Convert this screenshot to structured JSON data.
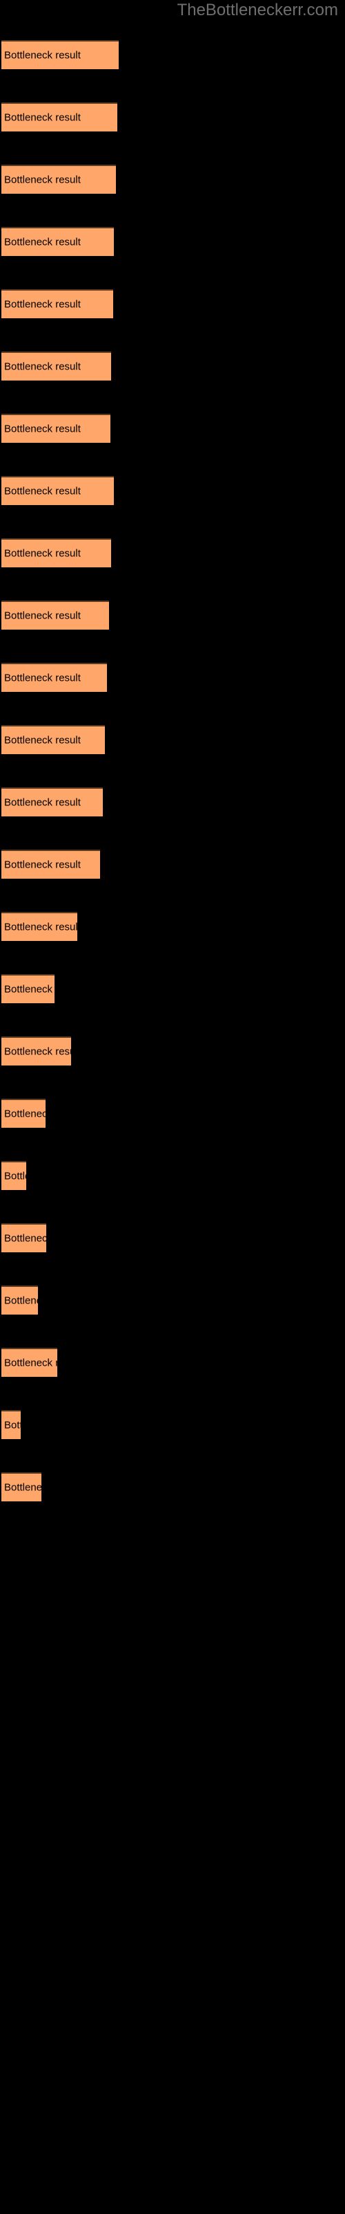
{
  "header": {
    "site_title": "TheBottleneckerr.com",
    "title_color": "#6f6f6f"
  },
  "colors": {
    "background": "#000000",
    "bar_fill": "#ffa76a",
    "bar_border_top": "#5b3a22",
    "bar_label_text": "#000000"
  },
  "chart_data": {
    "type": "bar",
    "orientation": "horizontal",
    "title": "",
    "xlabel": "",
    "ylabel": "",
    "grid": false,
    "legend": null,
    "axis_visible": false,
    "bar_label_text": "Bottleneck result",
    "categories": [
      "Bottleneck result",
      "Bottleneck result",
      "Bottleneck result",
      "Bottleneck result",
      "Bottleneck result",
      "Bottleneck result",
      "Bottleneck result",
      "Bottleneck result",
      "Bottleneck result",
      "Bottleneck result",
      "Bottleneck result",
      "Bottleneck result",
      "Bottleneck result",
      "Bottleneck result",
      "Bottleneck result",
      "Bottleneck result",
      "Bottleneck result",
      "Bottleneck result",
      "Bottleneck result",
      "Bottleneck result",
      "Bottleneck result",
      "Bottleneck result",
      "Bottleneck result",
      "Bottleneck result"
    ],
    "values": [
      170,
      168,
      166,
      163,
      162,
      159,
      158,
      163,
      159,
      156,
      153,
      150,
      147,
      143,
      110,
      77,
      101,
      64,
      36,
      65,
      53,
      81,
      28,
      58
    ],
    "xlim": [
      0,
      500
    ],
    "bars": [
      {
        "index": 1,
        "y": 58,
        "width": 170,
        "label": "Bottleneck result"
      },
      {
        "index": 2,
        "y": 148,
        "width": 168,
        "label": "Bottleneck result"
      },
      {
        "index": 3,
        "y": 238,
        "width": 166,
        "label": "Bottleneck result"
      },
      {
        "index": 4,
        "y": 328,
        "width": 163,
        "label": "Bottleneck result"
      },
      {
        "index": 5,
        "y": 418,
        "width": 162,
        "label": "Bottleneck result"
      },
      {
        "index": 6,
        "y": 508,
        "width": 159,
        "label": "Bottleneck result"
      },
      {
        "index": 7,
        "y": 598,
        "width": 158,
        "label": "Bottleneck result"
      },
      {
        "index": 8,
        "y": 688,
        "width": 163,
        "label": "Bottleneck result"
      },
      {
        "index": 9,
        "y": 778,
        "width": 159,
        "label": "Bottleneck result"
      },
      {
        "index": 10,
        "y": 868,
        "width": 156,
        "label": "Bottleneck result"
      },
      {
        "index": 11,
        "y": 958,
        "width": 153,
        "label": "Bottleneck result"
      },
      {
        "index": 12,
        "y": 1048,
        "width": 150,
        "label": "Bottleneck result"
      },
      {
        "index": 13,
        "y": 1138,
        "width": 147,
        "label": "Bottleneck result"
      },
      {
        "index": 14,
        "y": 1228,
        "width": 143,
        "label": "Bottleneck result"
      },
      {
        "index": 15,
        "y": 1318,
        "width": 110,
        "label": "Bottleneck result"
      },
      {
        "index": 16,
        "y": 1408,
        "width": 77,
        "label": "Bottleneck result"
      },
      {
        "index": 17,
        "y": 1498,
        "width": 101,
        "label": "Bottleneck result"
      },
      {
        "index": 18,
        "y": 1588,
        "width": 64,
        "label": "Bottleneck result"
      },
      {
        "index": 19,
        "y": 1678,
        "width": 36,
        "label": "Bottleneck result"
      },
      {
        "index": 20,
        "y": 1768,
        "width": 65,
        "label": "Bottleneck result"
      },
      {
        "index": 21,
        "y": 1858,
        "width": 53,
        "label": "Bottleneck result"
      },
      {
        "index": 22,
        "y": 1948,
        "width": 81,
        "label": "Bottleneck result"
      },
      {
        "index": 23,
        "y": 2038,
        "width": 28,
        "label": "Bottleneck result"
      },
      {
        "index": 24,
        "y": 2128,
        "width": 58,
        "label": "Bottleneck result"
      }
    ]
  }
}
